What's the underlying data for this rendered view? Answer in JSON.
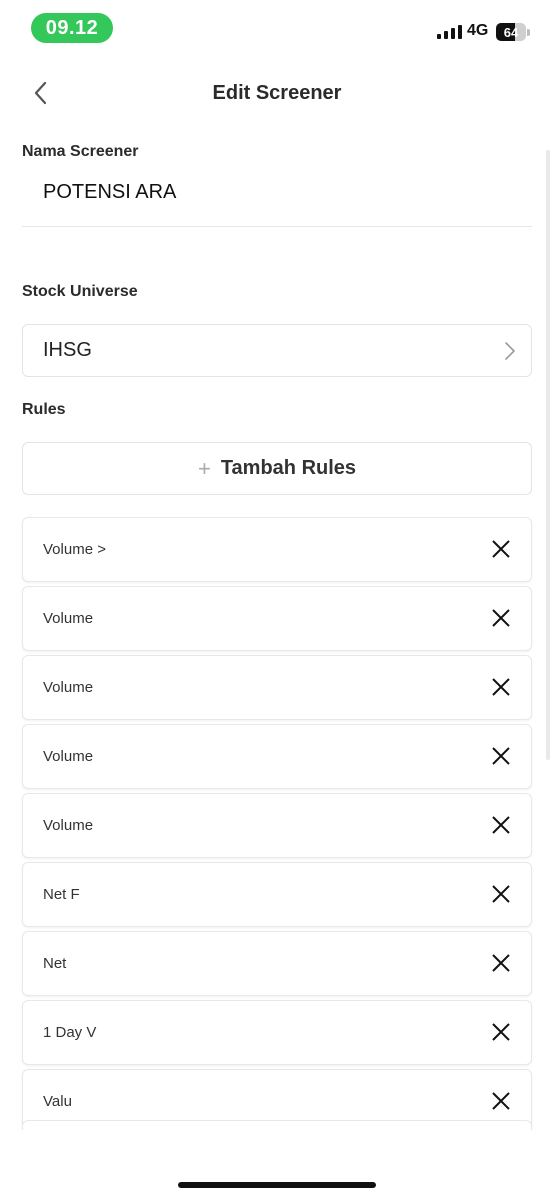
{
  "status_bar": {
    "time": "09.12",
    "network": "4G",
    "battery": "64"
  },
  "nav": {
    "title": "Edit Screener"
  },
  "form": {
    "name_label": "Nama Screener",
    "name_value": "POTENSI ARA",
    "universe_label": "Stock Universe",
    "universe_value": "IHSG",
    "rules_label": "Rules",
    "add_rules_label": "Tambah Rules"
  },
  "rules": [
    "Volume >",
    "Volume",
    "Volume",
    "Volume",
    "Volume",
    "Net F",
    "Net",
    "1 Day V",
    "Valu"
  ],
  "colors": {
    "time_pill": "#34c759",
    "text": "#2b2b2b"
  }
}
